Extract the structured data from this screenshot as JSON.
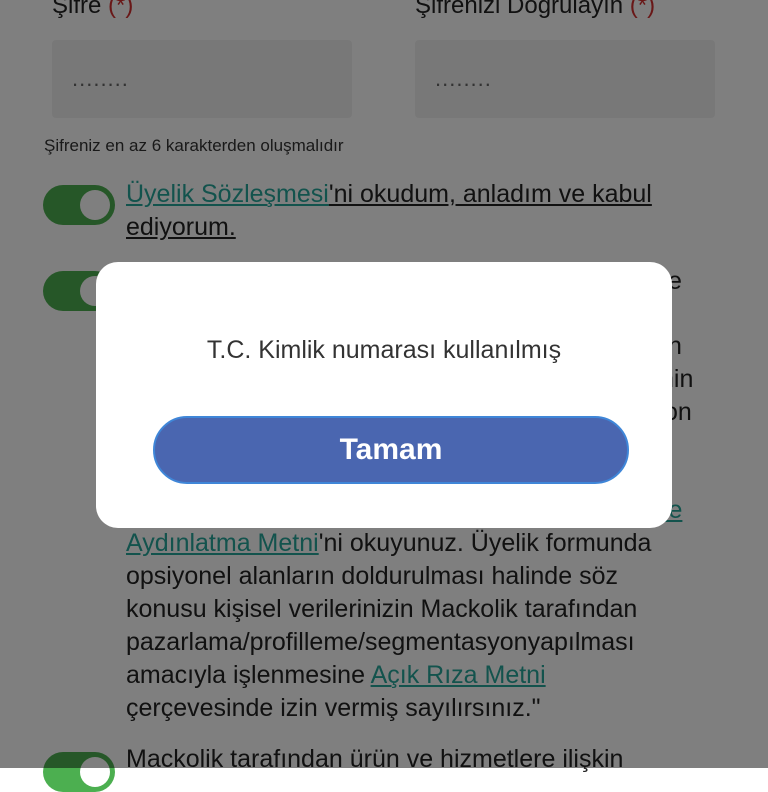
{
  "form": {
    "password_label": "Şifre",
    "password_confirm_label": "Şifrenizi Doğrulayın",
    "required_mark": "(*)",
    "password_value": "........",
    "password_confirm_value": "........",
    "password_hint": "Şifreniz en az 6 karakterden oluşmalıdır",
    "consent1": {
      "link": "Üyelik Sözleşmesi",
      "text1": "'ni okudum, anladım ve kabul",
      "text2": "ediyorum."
    },
    "consent2": {
      "partial_right_1": "e",
      "partial_right_2": "n",
      "partial_right_3": "nin",
      "partial_right_4": "on",
      "partial_link_right": "ye",
      "link": "Aydınlatma Metni",
      "line1_rest": "'ni okuyunuz. Üyelik formunda",
      "line2": "opsiyonel alanların doldurulması halinde söz",
      "line3": "konusu kişisel verilerinizin Mackolik tarafından",
      "line4": "pazarlama/profilleme/segmentasyonyapılması",
      "line5_start": "amacıyla işlenmesine",
      "line5_link": "Açık Rıza Metni",
      "line6": "çerçevesinde izin vermiş sayılırsınız.\""
    },
    "consent3": {
      "line1": "Mackolik tarafından ürün ve hizmetlere ilişkin"
    }
  },
  "dialog": {
    "message": "T.C. Kimlik numarası kullanılmış",
    "ok_label": "Tamam"
  },
  "colors": {
    "toggle_on": "#4caf50",
    "link": "#26a69a",
    "button": "#4a66b0",
    "required": "#d32f2f"
  }
}
